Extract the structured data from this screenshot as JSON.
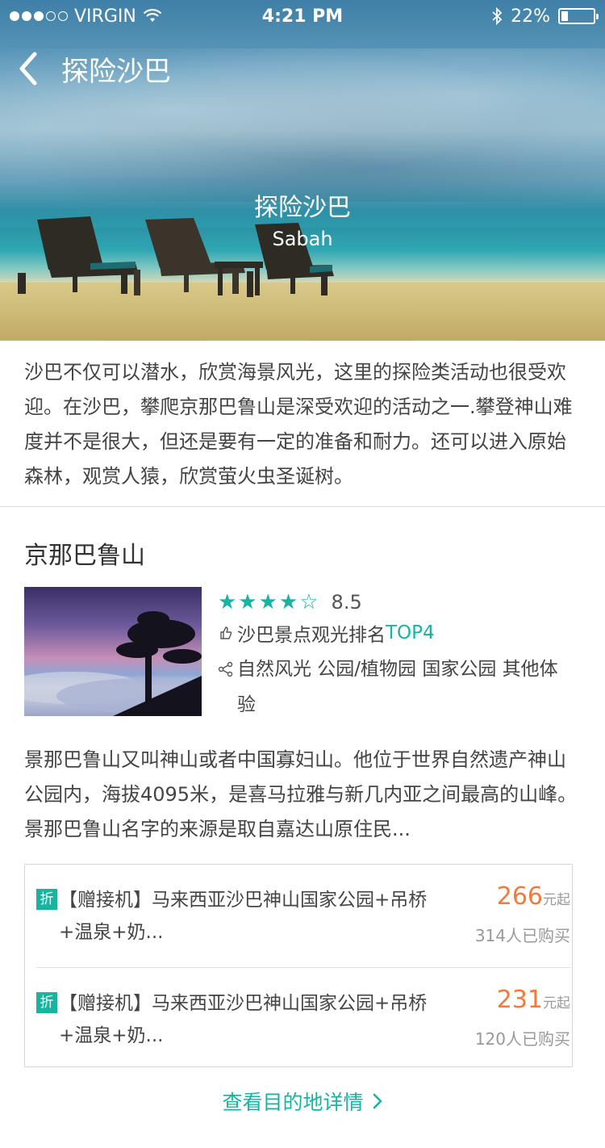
{
  "status_bar": {
    "carrier": "VIRGIN",
    "time": "4:21 PM",
    "battery": "22%",
    "battery_level": 0.22,
    "signal_bars_filled": 3,
    "signal_bars_total": 5
  },
  "nav": {
    "title": "探险沙巴",
    "back_icon": "chevron-left-icon"
  },
  "hero": {
    "title": "探险沙巴",
    "subtitle": "Sabah"
  },
  "intro": {
    "text": "沙巴不仅可以潜水，欣赏海景风光，这里的探险类活动也很受欢迎。在沙巴，攀爬京那巴鲁山是深受欢迎的活动之一.攀登神山难度并不是很大，但还是要有一定的准备和耐力。还可以进入原始森林，观赏人猿，欣赏萤火虫圣诞树。"
  },
  "attraction": {
    "name": "京那巴鲁山",
    "stars": "★★★★☆",
    "stars_value": 4,
    "score": "8.5",
    "rank_prefix": "沙巴景点观光排名",
    "rank_top": "TOP4",
    "tags": "自然风光 公园/植物园 国家公园 其他体验",
    "description": "景那巴鲁山又叫神山或者中国寡妇山。他位于世界自然遗产神山公园内，海拔4095米，是喜马拉雅与新几内亚之间最高的山峰。景那巴鲁山名字的来源是取自嘉达山原住民..."
  },
  "deals": [
    {
      "badge": "折",
      "name": "【赠接机】马来西亚沙巴神山国家公园+吊桥+温泉+奶...",
      "price": "266",
      "price_unit": "元起",
      "sold": "314人已购买"
    },
    {
      "badge": "折",
      "name": "【赠接机】马来西亚沙巴神山国家公园+吊桥+温泉+奶...",
      "price": "231",
      "price_unit": "元起",
      "sold": "120人已购买"
    }
  ],
  "footer": {
    "detail_link": "查看目的地详情"
  },
  "colors": {
    "accent": "#17b3a3",
    "price": "#f27a3a"
  }
}
